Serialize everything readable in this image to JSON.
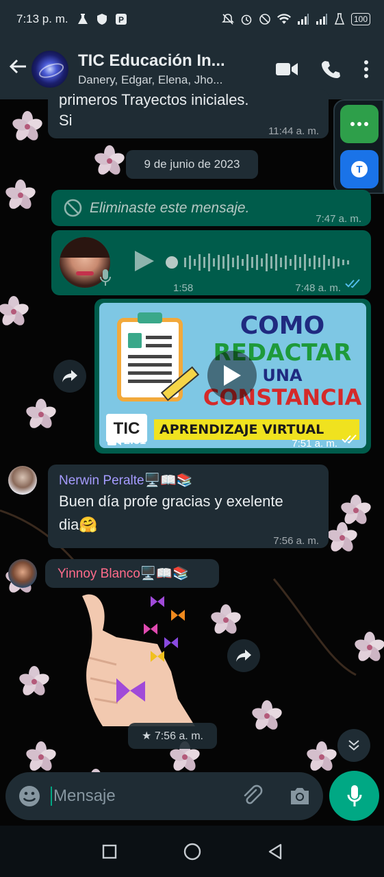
{
  "status": {
    "time": "7:13 p. m.",
    "battery": "100"
  },
  "header": {
    "title": "TIC  Educación In...",
    "subtitle": "Danery, Edgar, Elena, Jho..."
  },
  "messages": {
    "m1_line1": "primeros Trayectos iniciales.",
    "m1_line2": "Si",
    "m1_time": "11:44 a. m.",
    "date_chip": "9 de junio de 2023",
    "deleted_text": "Eliminaste este mensaje.",
    "deleted_time": "7:47 a. m.",
    "audio_duration": "1:58",
    "audio_time": "7:48 a. m.",
    "video": {
      "title_line1": "COMO",
      "title_line2": "REDACTAR",
      "title_line3": "UNA",
      "title_line4": "CONSTANCIA",
      "banner": "APRENDIZAJE VIRTUAL",
      "logo": "TIC",
      "duration": "2:51",
      "time": "7:51 a. m."
    },
    "nerwin": {
      "name": "Nerwin Peralte🖥️📖📚",
      "text_line1": "Buen día profe gracias y exelente",
      "text_line2": "dia🤗",
      "time": "7:56 a. m."
    },
    "yinnoy": {
      "name": "Yinnoy Blanco🖥️📖📚",
      "sticker_time": "★ 7:56 a. m."
    }
  },
  "floating": {
    "translate_label": "T"
  },
  "input": {
    "placeholder": "Mensaje"
  },
  "colors": {
    "outgoing": "#005c4b",
    "incoming": "#1f2c34",
    "accent": "#00a884",
    "nerwin_name": "#a59bff",
    "yinnoy_name": "#ff6b8a"
  }
}
